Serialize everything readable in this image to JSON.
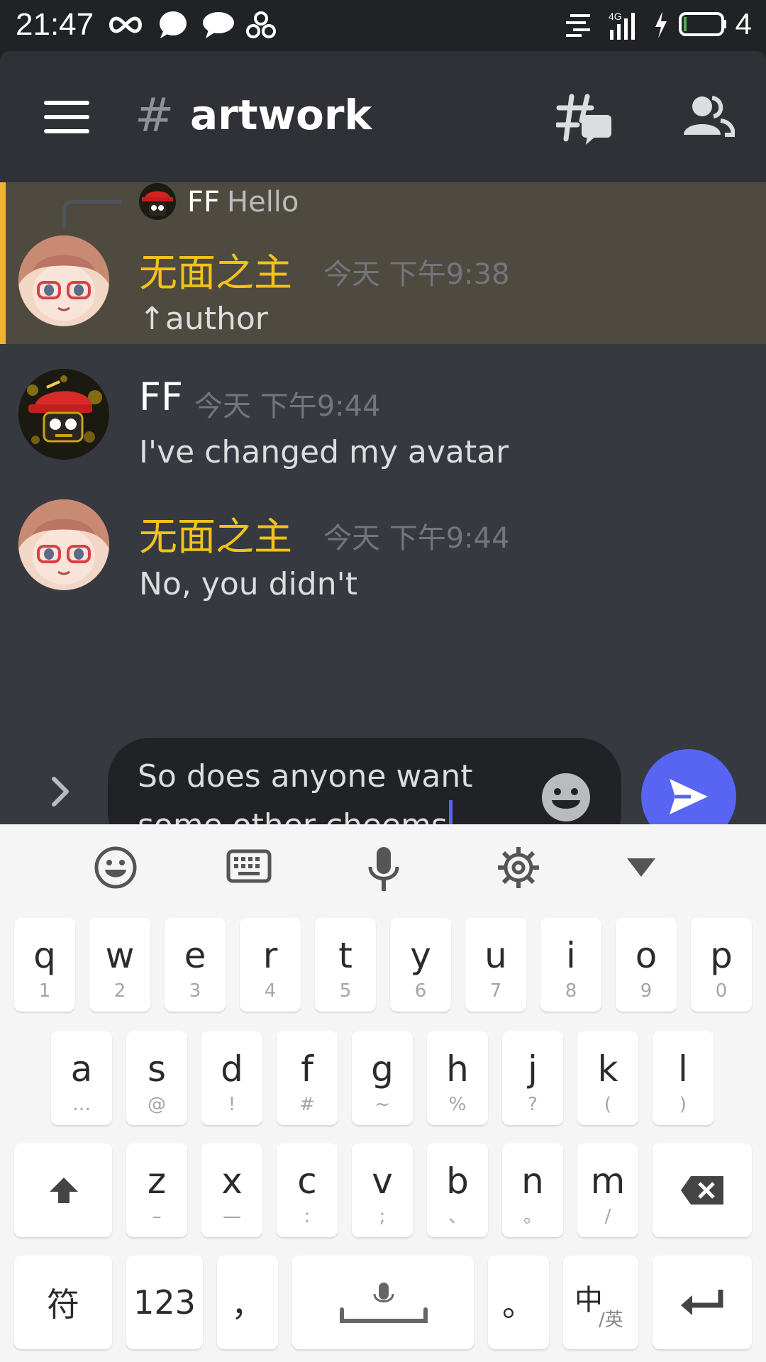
{
  "status_bar": {
    "time": "21:47",
    "network": "4G",
    "battery_level": "4"
  },
  "header": {
    "channel_hash": "#",
    "channel_name": "artwork",
    "icons": [
      "menu-icon",
      "threads-icon",
      "members-icon"
    ]
  },
  "messages": [
    {
      "reply_to": {
        "author": "FF",
        "text": "Hello"
      },
      "author": "无面之主",
      "author_color": "#f3c21a",
      "timestamp": "今天 下午9:38",
      "text": "↑author",
      "highlighted": true
    },
    {
      "author": "FF",
      "author_color": "#ffffff",
      "timestamp": "今天 下午9:44",
      "text": "I've changed my avatar"
    },
    {
      "author": "无面之主",
      "author_color": "#f3c21a",
      "timestamp": "今天 下午9:44",
      "text": "No, you didn't"
    }
  ],
  "composer": {
    "line1": "So does anyone want",
    "line2": "some other cheems",
    "send_color": "#5865f2"
  },
  "keyboard": {
    "toolbar": [
      "emoji-icon",
      "keyboard-icon",
      "microphone-icon",
      "settings-icon",
      "collapse-icon"
    ],
    "row1": [
      {
        "k": "q",
        "s": "1"
      },
      {
        "k": "w",
        "s": "2"
      },
      {
        "k": "e",
        "s": "3"
      },
      {
        "k": "r",
        "s": "4"
      },
      {
        "k": "t",
        "s": "5"
      },
      {
        "k": "y",
        "s": "6"
      },
      {
        "k": "u",
        "s": "7"
      },
      {
        "k": "i",
        "s": "8"
      },
      {
        "k": "o",
        "s": "9"
      },
      {
        "k": "p",
        "s": "0"
      }
    ],
    "row2": [
      {
        "k": "a",
        "s": "…"
      },
      {
        "k": "s",
        "s": "@"
      },
      {
        "k": "d",
        "s": "!"
      },
      {
        "k": "f",
        "s": "#"
      },
      {
        "k": "g",
        "s": "~"
      },
      {
        "k": "h",
        "s": "%"
      },
      {
        "k": "j",
        "s": "?"
      },
      {
        "k": "k",
        "s": "("
      },
      {
        "k": "l",
        "s": ")"
      }
    ],
    "row3": [
      {
        "k": "z",
        "s": "–"
      },
      {
        "k": "x",
        "s": "—"
      },
      {
        "k": "c",
        "s": ":"
      },
      {
        "k": "v",
        "s": ";"
      },
      {
        "k": "b",
        "s": "、"
      },
      {
        "k": "n",
        "s": "。"
      },
      {
        "k": "m",
        "s": "/"
      }
    ],
    "bottom": {
      "symbols": "符",
      "numbers": "123",
      "comma": "，",
      "period": "。",
      "lang_main": "中",
      "lang_sub": "/英"
    }
  }
}
